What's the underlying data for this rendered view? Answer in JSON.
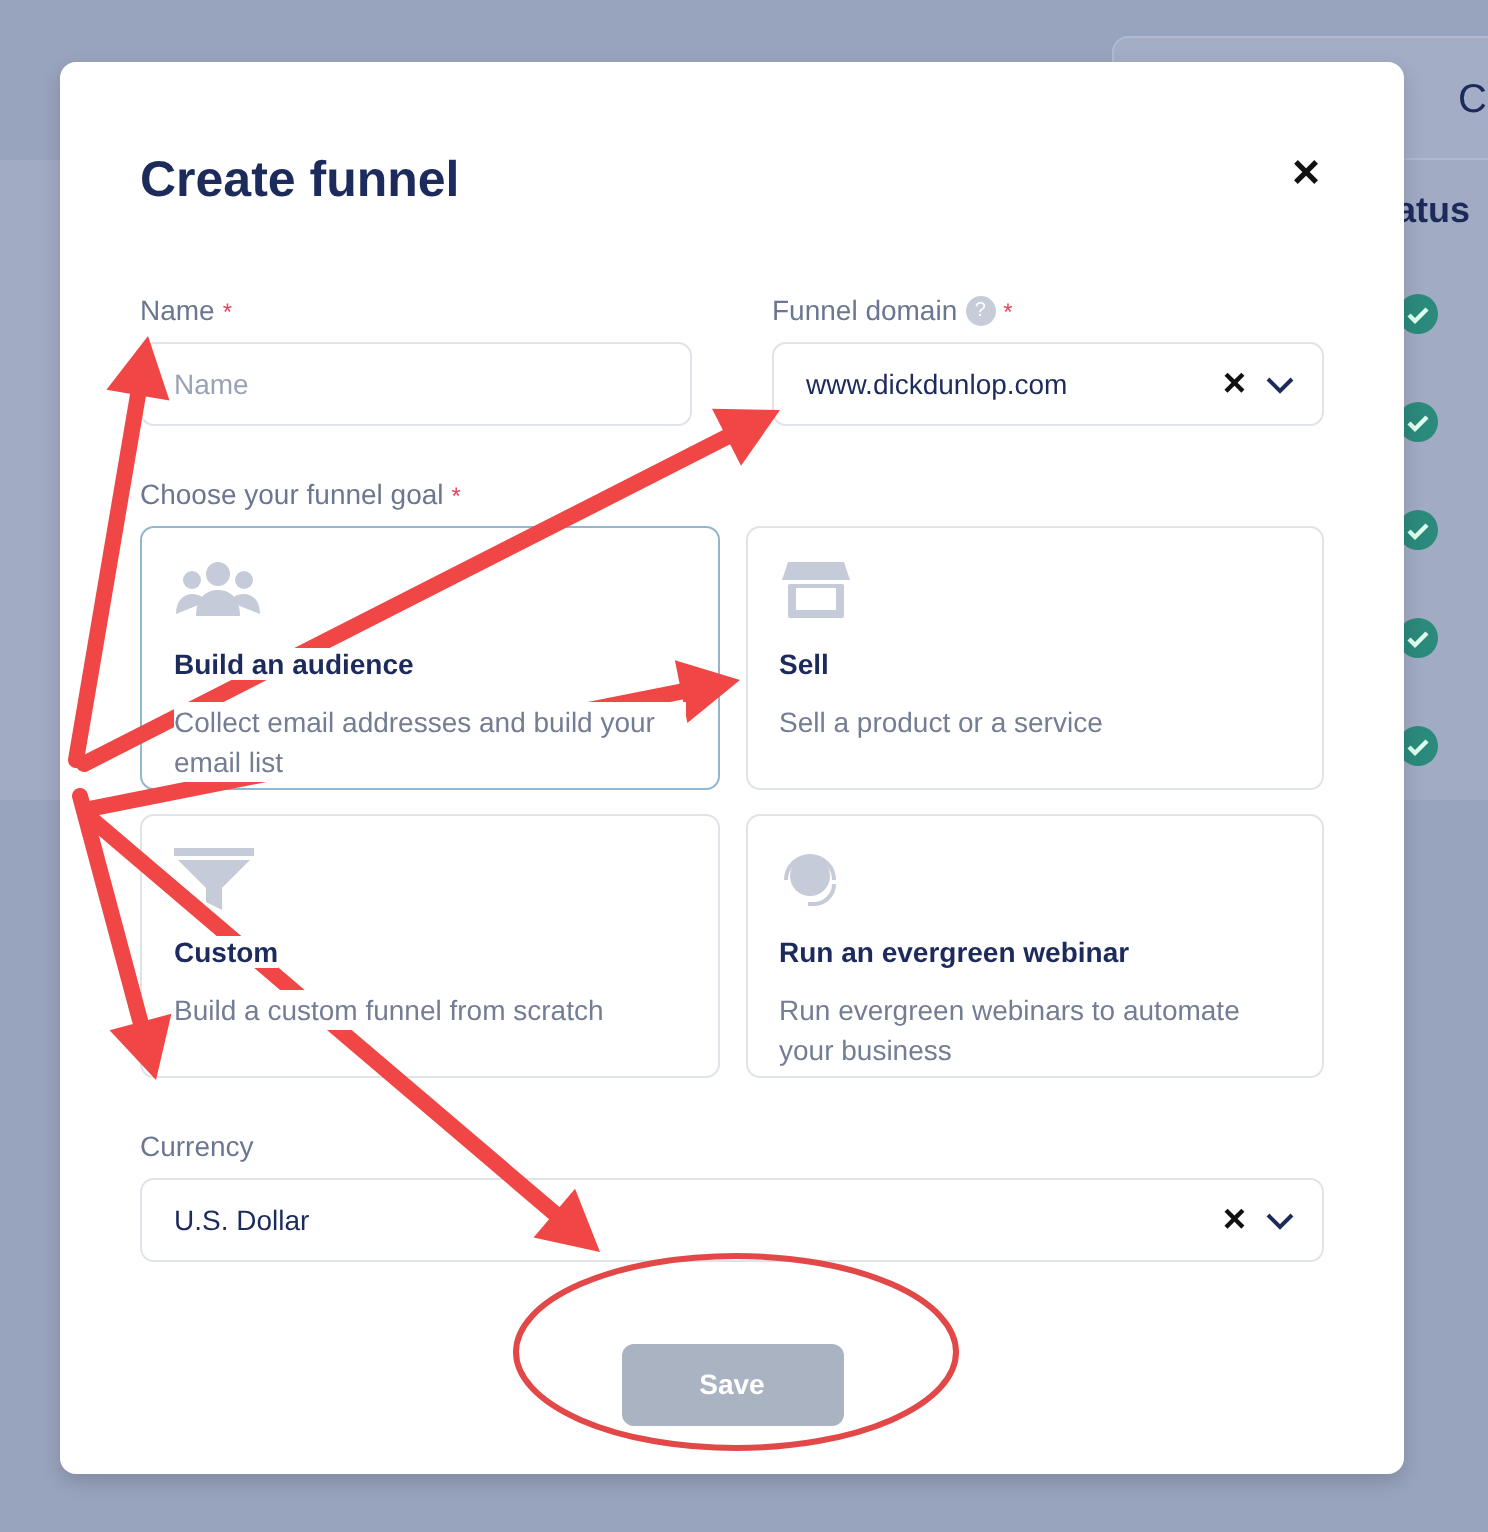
{
  "background": {
    "tab": "C",
    "column_header": "atus",
    "rows": [
      {
        "checked": true
      },
      {
        "checked": true
      },
      {
        "checked": true
      },
      {
        "checked": true
      },
      {
        "checked": true
      }
    ]
  },
  "dialog": {
    "title": "Create funnel",
    "close": "×",
    "name": {
      "label": "Name",
      "required_mark": "*",
      "placeholder": "Name"
    },
    "funnel_domain": {
      "label": "Funnel domain",
      "help": "?",
      "required_mark": "*",
      "value": "www.dickdunlop.com",
      "clear": "×"
    },
    "goal": {
      "label": "Choose your funnel goal",
      "required_mark": "*",
      "options": [
        {
          "title": "Build an audience",
          "description": "Collect email addresses and build your email list",
          "selected": true
        },
        {
          "title": "Sell",
          "description": "Sell a product or a service",
          "selected": false
        },
        {
          "title": "Custom",
          "description": "Build a custom funnel from scratch",
          "selected": false
        },
        {
          "title": "Run an evergreen webinar",
          "description": "Run evergreen webinars to automate your business",
          "selected": false
        }
      ]
    },
    "currency": {
      "label": "Currency",
      "value": "U.S. Dollar",
      "clear": "×"
    },
    "save": {
      "label": "Save",
      "disabled": true
    }
  }
}
